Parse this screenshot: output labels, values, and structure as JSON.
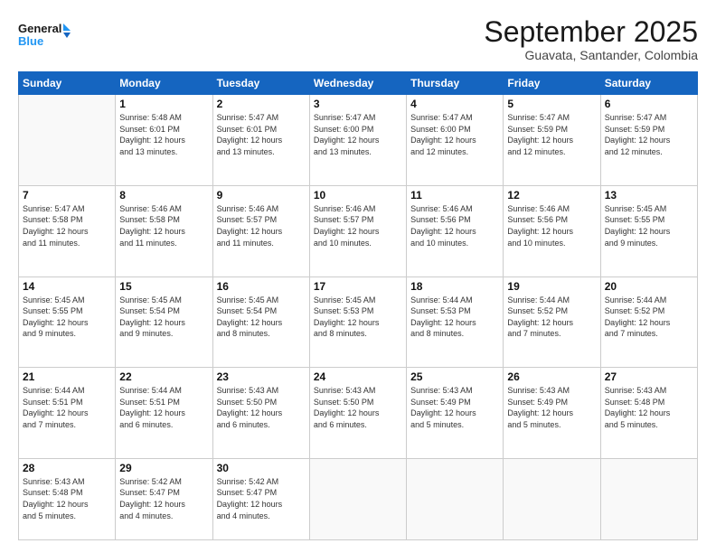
{
  "header": {
    "logo_line1": "General",
    "logo_line2": "Blue",
    "month_title": "September 2025",
    "subtitle": "Guavata, Santander, Colombia"
  },
  "weekdays": [
    "Sunday",
    "Monday",
    "Tuesday",
    "Wednesday",
    "Thursday",
    "Friday",
    "Saturday"
  ],
  "weeks": [
    [
      {
        "day": "",
        "info": ""
      },
      {
        "day": "1",
        "info": "Sunrise: 5:48 AM\nSunset: 6:01 PM\nDaylight: 12 hours\nand 13 minutes."
      },
      {
        "day": "2",
        "info": "Sunrise: 5:47 AM\nSunset: 6:01 PM\nDaylight: 12 hours\nand 13 minutes."
      },
      {
        "day": "3",
        "info": "Sunrise: 5:47 AM\nSunset: 6:00 PM\nDaylight: 12 hours\nand 13 minutes."
      },
      {
        "day": "4",
        "info": "Sunrise: 5:47 AM\nSunset: 6:00 PM\nDaylight: 12 hours\nand 12 minutes."
      },
      {
        "day": "5",
        "info": "Sunrise: 5:47 AM\nSunset: 5:59 PM\nDaylight: 12 hours\nand 12 minutes."
      },
      {
        "day": "6",
        "info": "Sunrise: 5:47 AM\nSunset: 5:59 PM\nDaylight: 12 hours\nand 12 minutes."
      }
    ],
    [
      {
        "day": "7",
        "info": "Sunrise: 5:47 AM\nSunset: 5:58 PM\nDaylight: 12 hours\nand 11 minutes."
      },
      {
        "day": "8",
        "info": "Sunrise: 5:46 AM\nSunset: 5:58 PM\nDaylight: 12 hours\nand 11 minutes."
      },
      {
        "day": "9",
        "info": "Sunrise: 5:46 AM\nSunset: 5:57 PM\nDaylight: 12 hours\nand 11 minutes."
      },
      {
        "day": "10",
        "info": "Sunrise: 5:46 AM\nSunset: 5:57 PM\nDaylight: 12 hours\nand 10 minutes."
      },
      {
        "day": "11",
        "info": "Sunrise: 5:46 AM\nSunset: 5:56 PM\nDaylight: 12 hours\nand 10 minutes."
      },
      {
        "day": "12",
        "info": "Sunrise: 5:46 AM\nSunset: 5:56 PM\nDaylight: 12 hours\nand 10 minutes."
      },
      {
        "day": "13",
        "info": "Sunrise: 5:45 AM\nSunset: 5:55 PM\nDaylight: 12 hours\nand 9 minutes."
      }
    ],
    [
      {
        "day": "14",
        "info": "Sunrise: 5:45 AM\nSunset: 5:55 PM\nDaylight: 12 hours\nand 9 minutes."
      },
      {
        "day": "15",
        "info": "Sunrise: 5:45 AM\nSunset: 5:54 PM\nDaylight: 12 hours\nand 9 minutes."
      },
      {
        "day": "16",
        "info": "Sunrise: 5:45 AM\nSunset: 5:54 PM\nDaylight: 12 hours\nand 8 minutes."
      },
      {
        "day": "17",
        "info": "Sunrise: 5:45 AM\nSunset: 5:53 PM\nDaylight: 12 hours\nand 8 minutes."
      },
      {
        "day": "18",
        "info": "Sunrise: 5:44 AM\nSunset: 5:53 PM\nDaylight: 12 hours\nand 8 minutes."
      },
      {
        "day": "19",
        "info": "Sunrise: 5:44 AM\nSunset: 5:52 PM\nDaylight: 12 hours\nand 7 minutes."
      },
      {
        "day": "20",
        "info": "Sunrise: 5:44 AM\nSunset: 5:52 PM\nDaylight: 12 hours\nand 7 minutes."
      }
    ],
    [
      {
        "day": "21",
        "info": "Sunrise: 5:44 AM\nSunset: 5:51 PM\nDaylight: 12 hours\nand 7 minutes."
      },
      {
        "day": "22",
        "info": "Sunrise: 5:44 AM\nSunset: 5:51 PM\nDaylight: 12 hours\nand 6 minutes."
      },
      {
        "day": "23",
        "info": "Sunrise: 5:43 AM\nSunset: 5:50 PM\nDaylight: 12 hours\nand 6 minutes."
      },
      {
        "day": "24",
        "info": "Sunrise: 5:43 AM\nSunset: 5:50 PM\nDaylight: 12 hours\nand 6 minutes."
      },
      {
        "day": "25",
        "info": "Sunrise: 5:43 AM\nSunset: 5:49 PM\nDaylight: 12 hours\nand 5 minutes."
      },
      {
        "day": "26",
        "info": "Sunrise: 5:43 AM\nSunset: 5:49 PM\nDaylight: 12 hours\nand 5 minutes."
      },
      {
        "day": "27",
        "info": "Sunrise: 5:43 AM\nSunset: 5:48 PM\nDaylight: 12 hours\nand 5 minutes."
      }
    ],
    [
      {
        "day": "28",
        "info": "Sunrise: 5:43 AM\nSunset: 5:48 PM\nDaylight: 12 hours\nand 5 minutes."
      },
      {
        "day": "29",
        "info": "Sunrise: 5:42 AM\nSunset: 5:47 PM\nDaylight: 12 hours\nand 4 minutes."
      },
      {
        "day": "30",
        "info": "Sunrise: 5:42 AM\nSunset: 5:47 PM\nDaylight: 12 hours\nand 4 minutes."
      },
      {
        "day": "",
        "info": ""
      },
      {
        "day": "",
        "info": ""
      },
      {
        "day": "",
        "info": ""
      },
      {
        "day": "",
        "info": ""
      }
    ]
  ]
}
